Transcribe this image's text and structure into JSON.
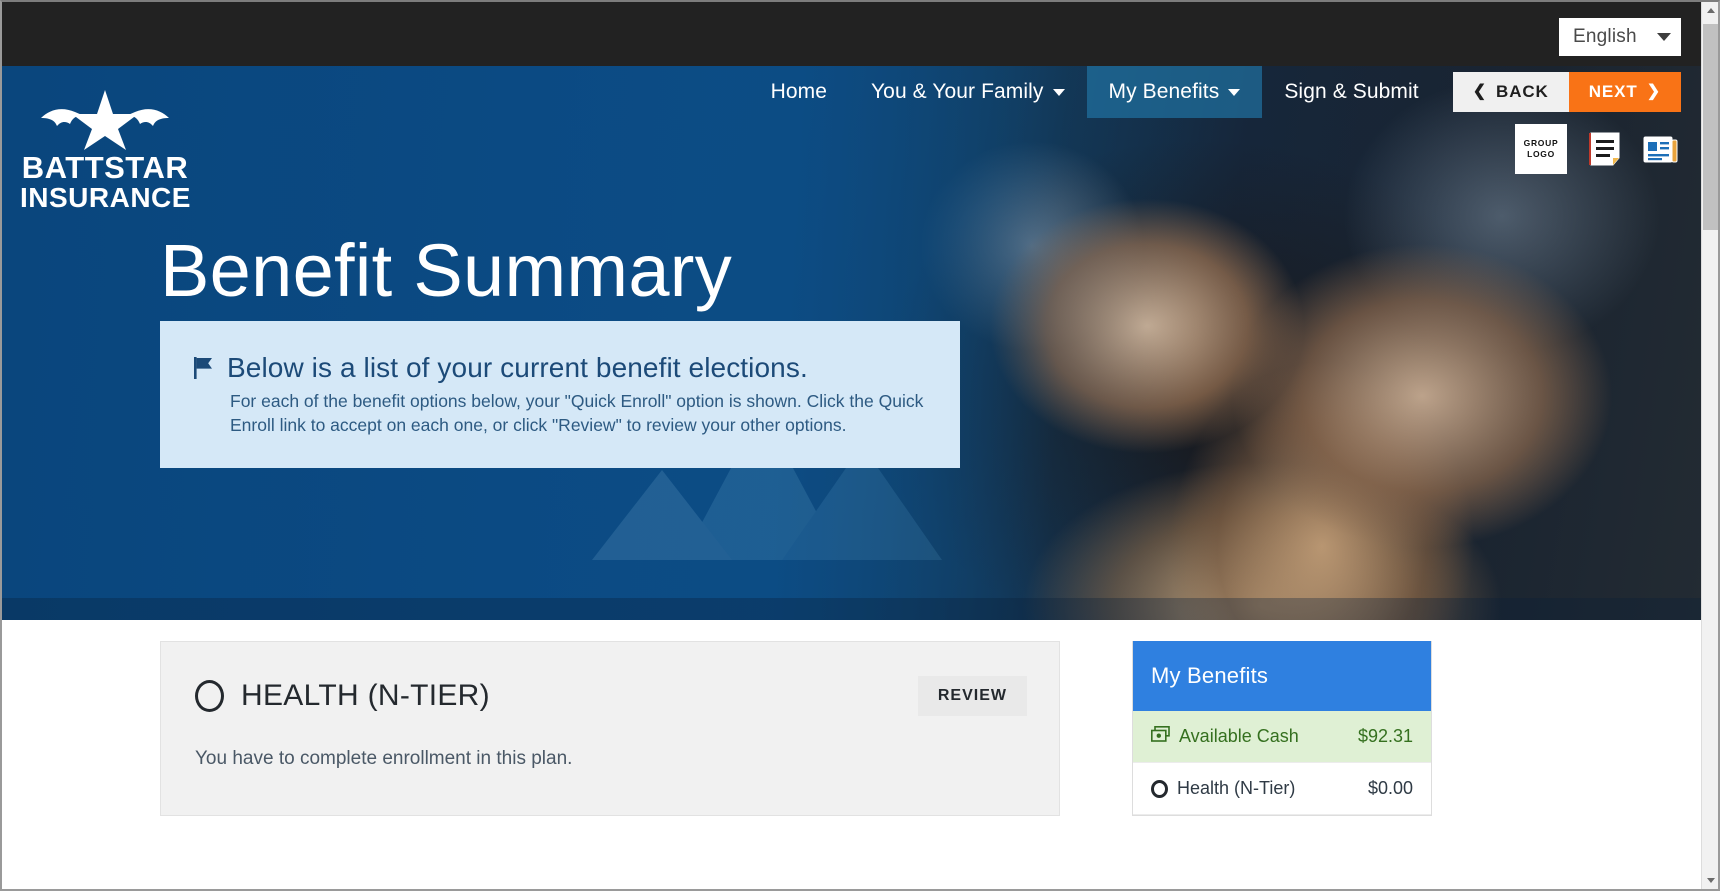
{
  "topbar": {
    "language": {
      "selected": "English",
      "caret_icon": "chevron-down-icon"
    }
  },
  "brand": {
    "logo_icon": "battstar-bat-star-logo",
    "name": "BATTSTAR",
    "sub": "INSURANCE"
  },
  "nav": {
    "items": [
      {
        "label": "Home",
        "has_caret": false,
        "active": false
      },
      {
        "label": "You & Your Family",
        "has_caret": true,
        "active": false
      },
      {
        "label": "My Benefits",
        "has_caret": true,
        "active": true
      },
      {
        "label": "Sign & Submit",
        "has_caret": false,
        "active": false
      }
    ],
    "back_label": "BACK",
    "next_label": "NEXT",
    "back_icon": "chevron-left-icon",
    "next_icon": "chevron-right-icon"
  },
  "header_icons": {
    "group_logo_line1": "GROUP",
    "group_logo_line2": "LOGO",
    "document_icon": "document-icon",
    "newspaper_icon": "newspaper-icon"
  },
  "hero": {
    "title": "Benefit Summary",
    "info": {
      "flag_icon": "flag-icon",
      "heading": "Below is a list of your current benefit elections.",
      "body": "For each of the benefit options below, your \"Quick Enroll\" option is shown. Click the Quick Enroll link to accept on each one, or click \"Review\" to review your other options."
    }
  },
  "main": {
    "card": {
      "status_icon": "empty-circle-icon",
      "title": "HEALTH (N-TIER)",
      "review_label": "REVIEW",
      "note": "You have to complete enrollment in this plan."
    }
  },
  "sidebar": {
    "title": "My Benefits",
    "rows": [
      {
        "icon": "cash-stack-icon",
        "label": "Available Cash",
        "amount": "$92.31",
        "type": "cash"
      },
      {
        "icon": "empty-circle-icon",
        "label": "Health (N-Tier)",
        "amount": "$0.00",
        "type": "plan"
      }
    ]
  },
  "colors": {
    "topbar": "#222222",
    "hero_blue": "#0c4a80",
    "info_panel": "#d5e8f7",
    "info_text": "#1c4a78",
    "next_orange": "#f97316",
    "sidebar_header": "#2f80e0",
    "cash_row_bg": "#dff0d4",
    "cash_row_text": "#35701f",
    "card_bg": "#f1f1f1"
  },
  "scrollbar": {
    "up_icon": "scroll-up-arrow-icon",
    "down_icon": "scroll-down-arrow-icon"
  }
}
